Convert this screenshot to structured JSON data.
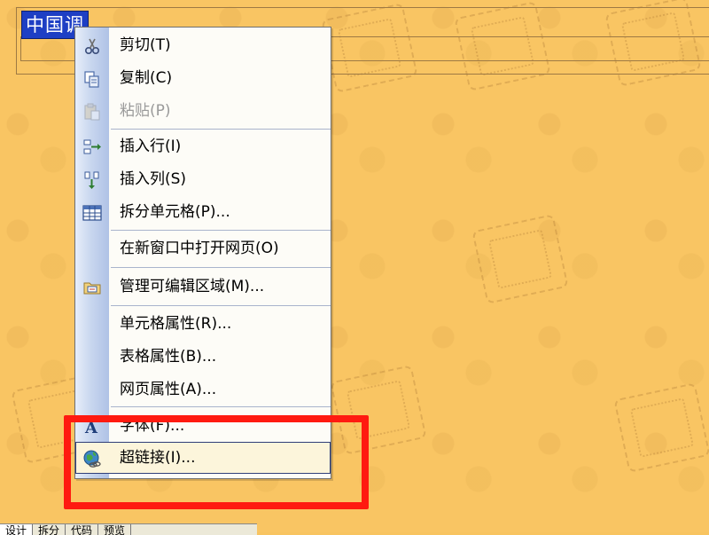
{
  "page": {
    "title_text": "中国调"
  },
  "context_menu": {
    "items": [
      {
        "label": "剪切(T)",
        "icon": "scissors-icon",
        "disabled": false
      },
      {
        "label": "复制(C)",
        "icon": "copy-icon",
        "disabled": false
      },
      {
        "label": "粘贴(P)",
        "icon": "paste-icon",
        "disabled": true
      },
      {
        "label": "插入行(I)",
        "icon": "insert-row-icon",
        "disabled": false
      },
      {
        "label": "插入列(S)",
        "icon": "insert-column-icon",
        "disabled": false
      },
      {
        "label": "拆分单元格(P)...",
        "icon": "split-cell-icon",
        "disabled": false
      },
      {
        "label": "在新窗口中打开网页(O)",
        "icon": "",
        "disabled": false
      },
      {
        "label": "管理可编辑区域(M)...",
        "icon": "editable-region-icon",
        "disabled": false
      },
      {
        "label": "单元格属性(R)...",
        "icon": "",
        "disabled": false
      },
      {
        "label": "表格属性(B)...",
        "icon": "",
        "disabled": false
      },
      {
        "label": "网页属性(A)...",
        "icon": "",
        "disabled": false
      },
      {
        "label": "字体(F)...",
        "icon": "font-icon",
        "disabled": false
      },
      {
        "label": "超链接(I)...",
        "icon": "hyperlink-globe-icon",
        "disabled": false,
        "highlighted": true
      }
    ]
  },
  "view_tabs": {
    "items": [
      "设计",
      "拆分",
      "代码",
      "预览"
    ]
  },
  "colors": {
    "page_bg": "#F9C563",
    "selection_bg": "#1E3FC4",
    "menu_bg": "#FDFCF7",
    "highlight_border": "#2F3E78",
    "annotation_red": "#FF1A10"
  }
}
